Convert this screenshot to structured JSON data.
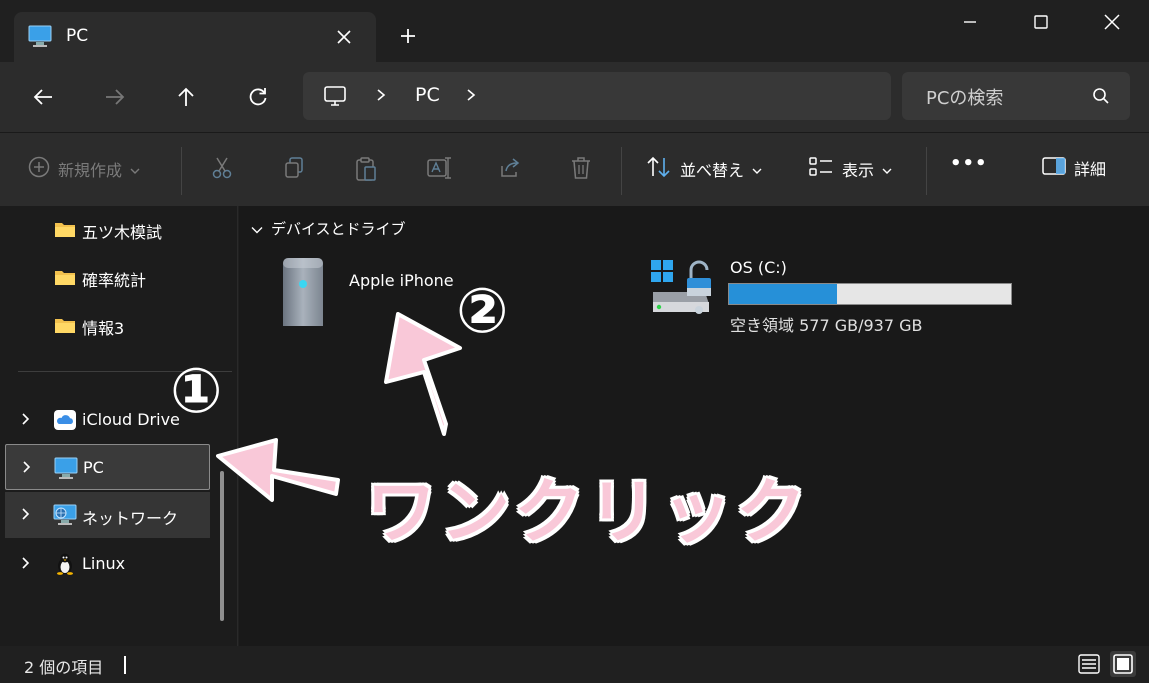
{
  "window": {
    "tab_title": "PC",
    "new_tab_label": "+",
    "controls": [
      "minimize-icon",
      "maximize-icon",
      "close-icon"
    ]
  },
  "navigation": {
    "back_icon": "arrow-left-icon",
    "forward_icon": "arrow-right-icon",
    "up_icon": "arrow-up-icon",
    "refresh_icon": "refresh-icon",
    "address": {
      "location": "PC"
    },
    "search": {
      "placeholder": "PCの検索"
    }
  },
  "commandbar": {
    "new_label": "新規作成",
    "sort_label": "並べ替え",
    "view_label": "表示",
    "more_label": "•••",
    "details_label": "詳細",
    "disabled_actions": [
      "cut-icon",
      "copy-icon",
      "paste-icon",
      "rename-icon",
      "share-icon",
      "delete-icon"
    ]
  },
  "sidebar": {
    "folders": [
      {
        "label": "五ツ木模試"
      },
      {
        "label": "確率統計"
      },
      {
        "label": "情報3"
      }
    ],
    "locations": [
      {
        "label": "iCloud Drive",
        "icon": "icloud-icon"
      },
      {
        "label": "PC",
        "icon": "pc-icon",
        "selected": true
      },
      {
        "label": "ネットワーク",
        "icon": "network-icon"
      },
      {
        "label": "Linux",
        "icon": "linux-penguin-icon"
      }
    ]
  },
  "content": {
    "group_title": "デバイスとドライブ",
    "devices": [
      {
        "label": "Apple iPhone",
        "icon": "portable-device-icon"
      }
    ],
    "drives": [
      {
        "label": "OS (C:)",
        "free_text": "空き領域 577 GB/937 GB",
        "used_fraction": 0.384,
        "bar_color": "#2690d8"
      }
    ]
  },
  "annotations": {
    "step1": "①",
    "step2": "②",
    "instruction": "ワンクリック",
    "arrow_color": "#f9c8d8"
  },
  "status": {
    "item_count": "2 個の項目"
  }
}
